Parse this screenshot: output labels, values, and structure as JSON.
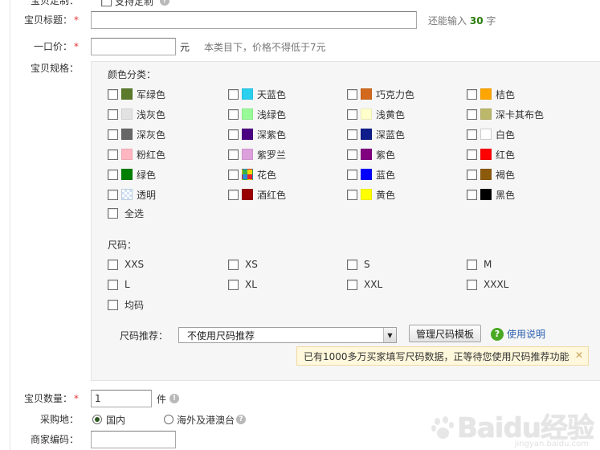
{
  "form": {
    "custom_label": "宝贝定制：",
    "custom_option": "支持定制",
    "title_label": "宝贝标题：",
    "title_value": "",
    "title_hint_prefix": "还能输入",
    "title_hint_count": "30",
    "title_hint_suffix": "字",
    "price_label": "一口价：",
    "price_value": "",
    "price_unit": "元",
    "price_hint": "本类目下，价格不得低于7元",
    "spec_label": "宝贝规格：",
    "qty_label": "宝贝数量：",
    "qty_value": "1",
    "qty_unit": "件",
    "purchase_label": "采购地：",
    "purchase_domestic": "国内",
    "purchase_overseas": "海外及港澳台",
    "merchant_label": "商家编码：",
    "required_mark": "*"
  },
  "spec": {
    "color_title": "颜色分类：",
    "colors": [
      {
        "label": "军绿色",
        "color": "#5b7a2b"
      },
      {
        "label": "天蓝色",
        "color": "#2ad0ee"
      },
      {
        "label": "巧克力色",
        "color": "#d2691e"
      },
      {
        "label": "桔色",
        "color": "#ffa500"
      },
      {
        "label": "浅灰色",
        "color": "#e2e2e2"
      },
      {
        "label": "浅绿色",
        "color": "#98fb98"
      },
      {
        "label": "浅黄色",
        "color": "#ffffcc"
      },
      {
        "label": "深卡其布色",
        "color": "#bdb76b"
      },
      {
        "label": "深灰色",
        "color": "#666666"
      },
      {
        "label": "深紫色",
        "color": "#4b0082"
      },
      {
        "label": "深蓝色",
        "color": "#0e1d8a"
      },
      {
        "label": "白色",
        "color": "#ffffff"
      },
      {
        "label": "粉红色",
        "color": "#ffb6c1"
      },
      {
        "label": "紫罗兰",
        "color": "#dda0dd"
      },
      {
        "label": "紫色",
        "color": "#800080"
      },
      {
        "label": "红色",
        "color": "#ff0000"
      },
      {
        "label": "绿色",
        "color": "#008000"
      },
      {
        "label": "花色",
        "color": "flower"
      },
      {
        "label": "蓝色",
        "color": "#0000ff"
      },
      {
        "label": "褐色",
        "color": "#8b5a0b"
      },
      {
        "label": "透明",
        "color": "transparent"
      },
      {
        "label": "酒红色",
        "color": "#990000"
      },
      {
        "label": "黄色",
        "color": "#ffff00"
      },
      {
        "label": "黑色",
        "color": "#000000"
      }
    ],
    "select_all": "全选",
    "size_title": "尺码：",
    "sizes": [
      "XXS",
      "XS",
      "S",
      "M",
      "L",
      "XL",
      "XXL",
      "XXXL",
      "均码"
    ],
    "recommend_label": "尺码推荐：",
    "recommend_value": "不使用尺码推荐",
    "manage_button": "管理尺码模板",
    "help_link": "使用说明",
    "tip": "已有1000多万买家填写尺码数据，正等待您使用尺码推荐功能"
  },
  "watermark": {
    "brand": "Baidu经验",
    "url": "jingyan.baidu.com"
  }
}
